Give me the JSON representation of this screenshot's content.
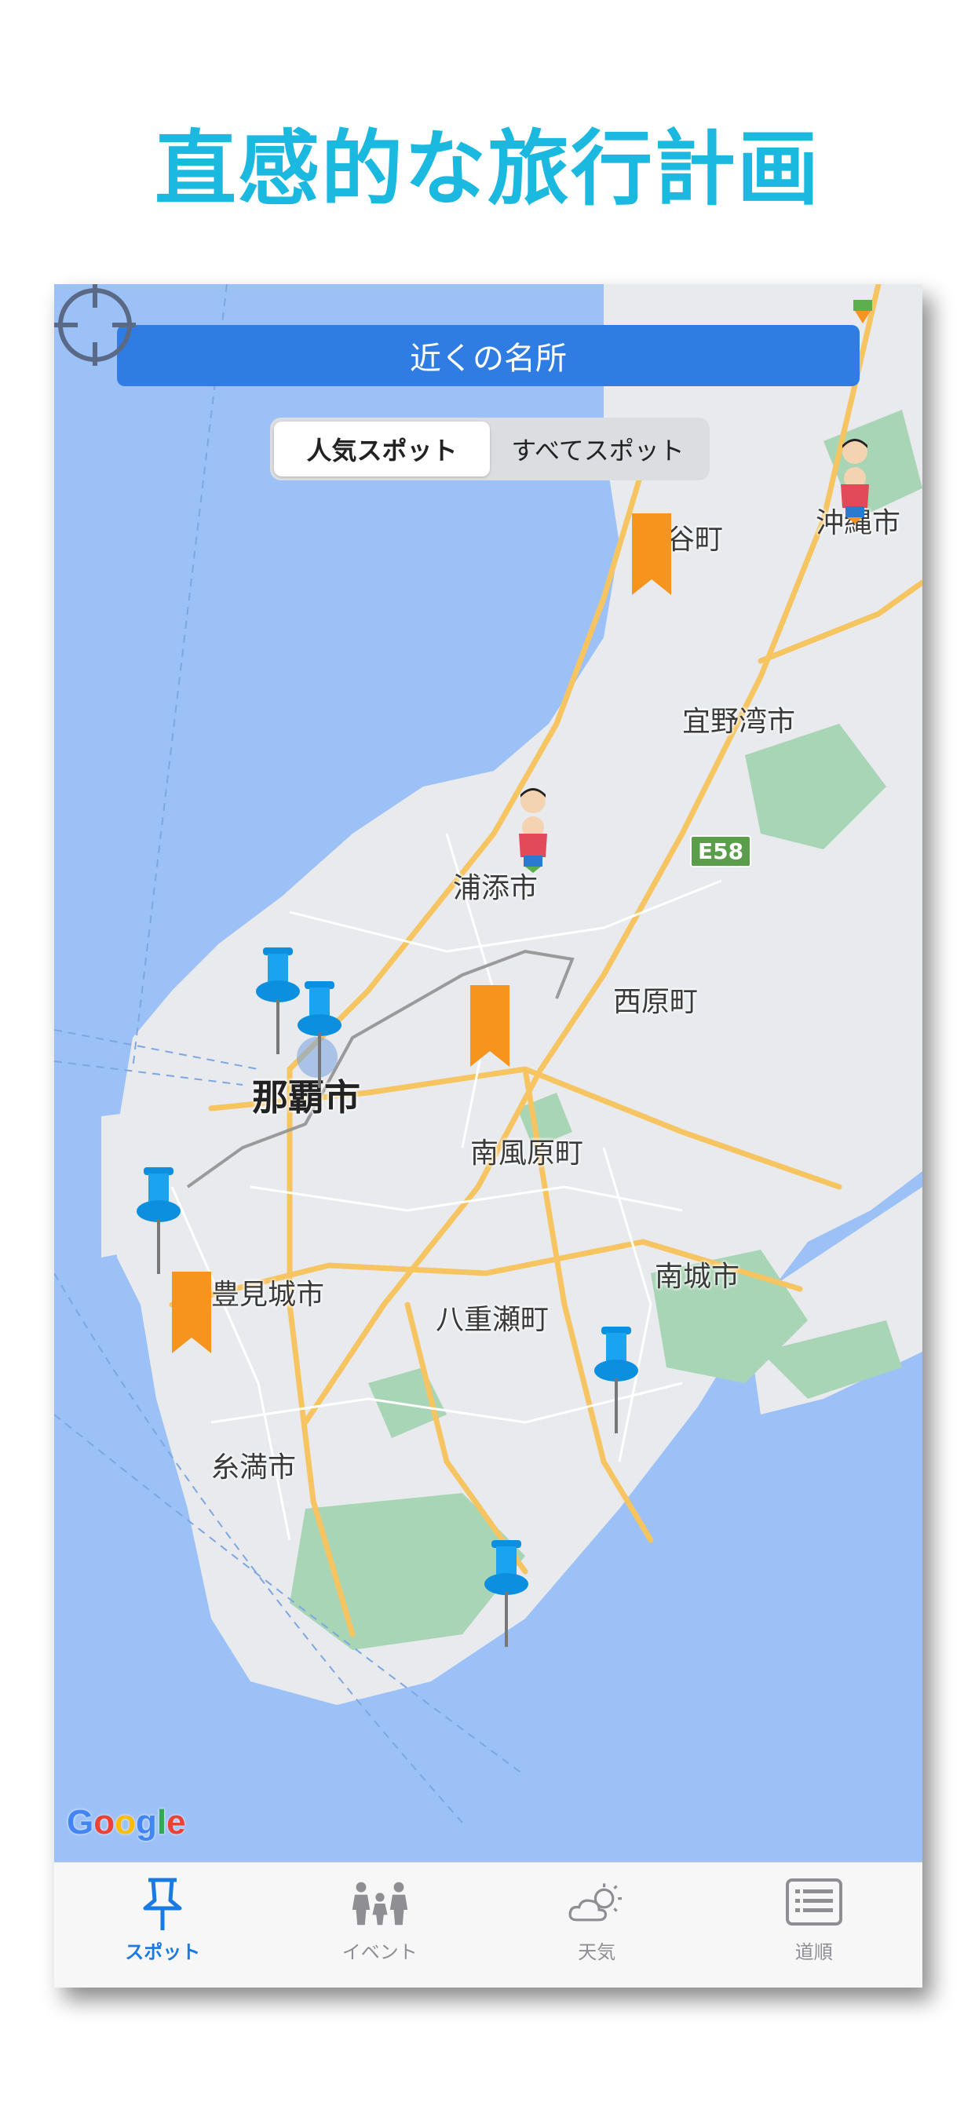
{
  "headline": "直感的な旅行計画",
  "header": {
    "title": "近くの名所"
  },
  "segment": {
    "options": [
      "人気スポット",
      "すべてスポット"
    ],
    "selected": "人気スポット"
  },
  "map": {
    "labels": {
      "naha": "那覇市",
      "urasoe": "浦添市",
      "ginowan": "宜野湾市",
      "nishihara": "西原町",
      "haebaru": "南風原町",
      "nanjo": "南城市",
      "yaese": "八重瀬町",
      "tomigusuku": "豊見城市",
      "itoman": "糸満市",
      "chatan": "谷町",
      "okinawa": "沖縄市"
    },
    "road_badge": "E58",
    "attribution": "Google",
    "colors": {
      "sea": "#9cc1f7",
      "land": "#e8eaed",
      "park": "#a8d5b5",
      "road": "#f6c460",
      "title_bar": "#2f7de3"
    }
  },
  "tabs": [
    {
      "label": "スポット",
      "icon": "pushpin-icon",
      "active": true
    },
    {
      "label": "イベント",
      "icon": "people-icon",
      "active": false
    },
    {
      "label": "天気",
      "icon": "weather-icon",
      "active": false
    },
    {
      "label": "道順",
      "icon": "list-icon",
      "active": false
    }
  ]
}
